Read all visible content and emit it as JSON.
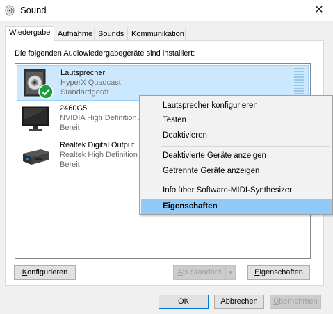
{
  "window": {
    "title": "Sound",
    "close_glyph": "✕"
  },
  "tabs": [
    {
      "label": "Wiedergabe",
      "active": true
    },
    {
      "label": "Aufnahme",
      "active": false
    },
    {
      "label": "Sounds",
      "active": false
    },
    {
      "label": "Kommunikation",
      "active": false
    }
  ],
  "panel": {
    "label": "Die folgenden Audiowiedergabegeräte sind installiert:"
  },
  "devices": [
    {
      "name": "Lautsprecher",
      "line2": "HyperX Quadcast",
      "line3": "Standardgerät",
      "icon": "speaker-icon",
      "selected": true,
      "default_badge": "check-badge-icon"
    },
    {
      "name": "2460G5",
      "line2": "NVIDIA High Definition Audio",
      "line3": "Bereit",
      "icon": "monitor-icon",
      "selected": false
    },
    {
      "name": "Realtek Digital Output",
      "line2": "Realtek High Definition Audio",
      "line3": "Bereit",
      "icon": "digital-output-icon",
      "selected": false
    }
  ],
  "buttons": {
    "configure_mnemonic": "K",
    "configure_rest": "onfigurieren",
    "set_default_mnemonic": "A",
    "set_default_rest": "ls Standard",
    "properties_mnemonic": "E",
    "properties_rest": "igenschaften",
    "ok": "OK",
    "cancel": "Abbrechen",
    "apply_mnemonic": "Ü",
    "apply_rest": "bernehmen"
  },
  "context_menu": {
    "items": [
      {
        "label": "Lautsprecher konfigurieren"
      },
      {
        "label": "Testen"
      },
      {
        "label": "Deaktivieren"
      },
      {
        "label": "Deaktivierte Geräte anzeigen"
      },
      {
        "label": "Getrennte Geräte anzeigen"
      },
      {
        "label": "Info über Software-MIDI-Synthesizer"
      },
      {
        "label": "Eigenschaften",
        "highlighted": true
      }
    ]
  },
  "colors": {
    "selection": "#cce8ff",
    "menu_highlight": "#91c9f7",
    "accent": "#0078d7",
    "check_green": "#1e9e3e"
  }
}
